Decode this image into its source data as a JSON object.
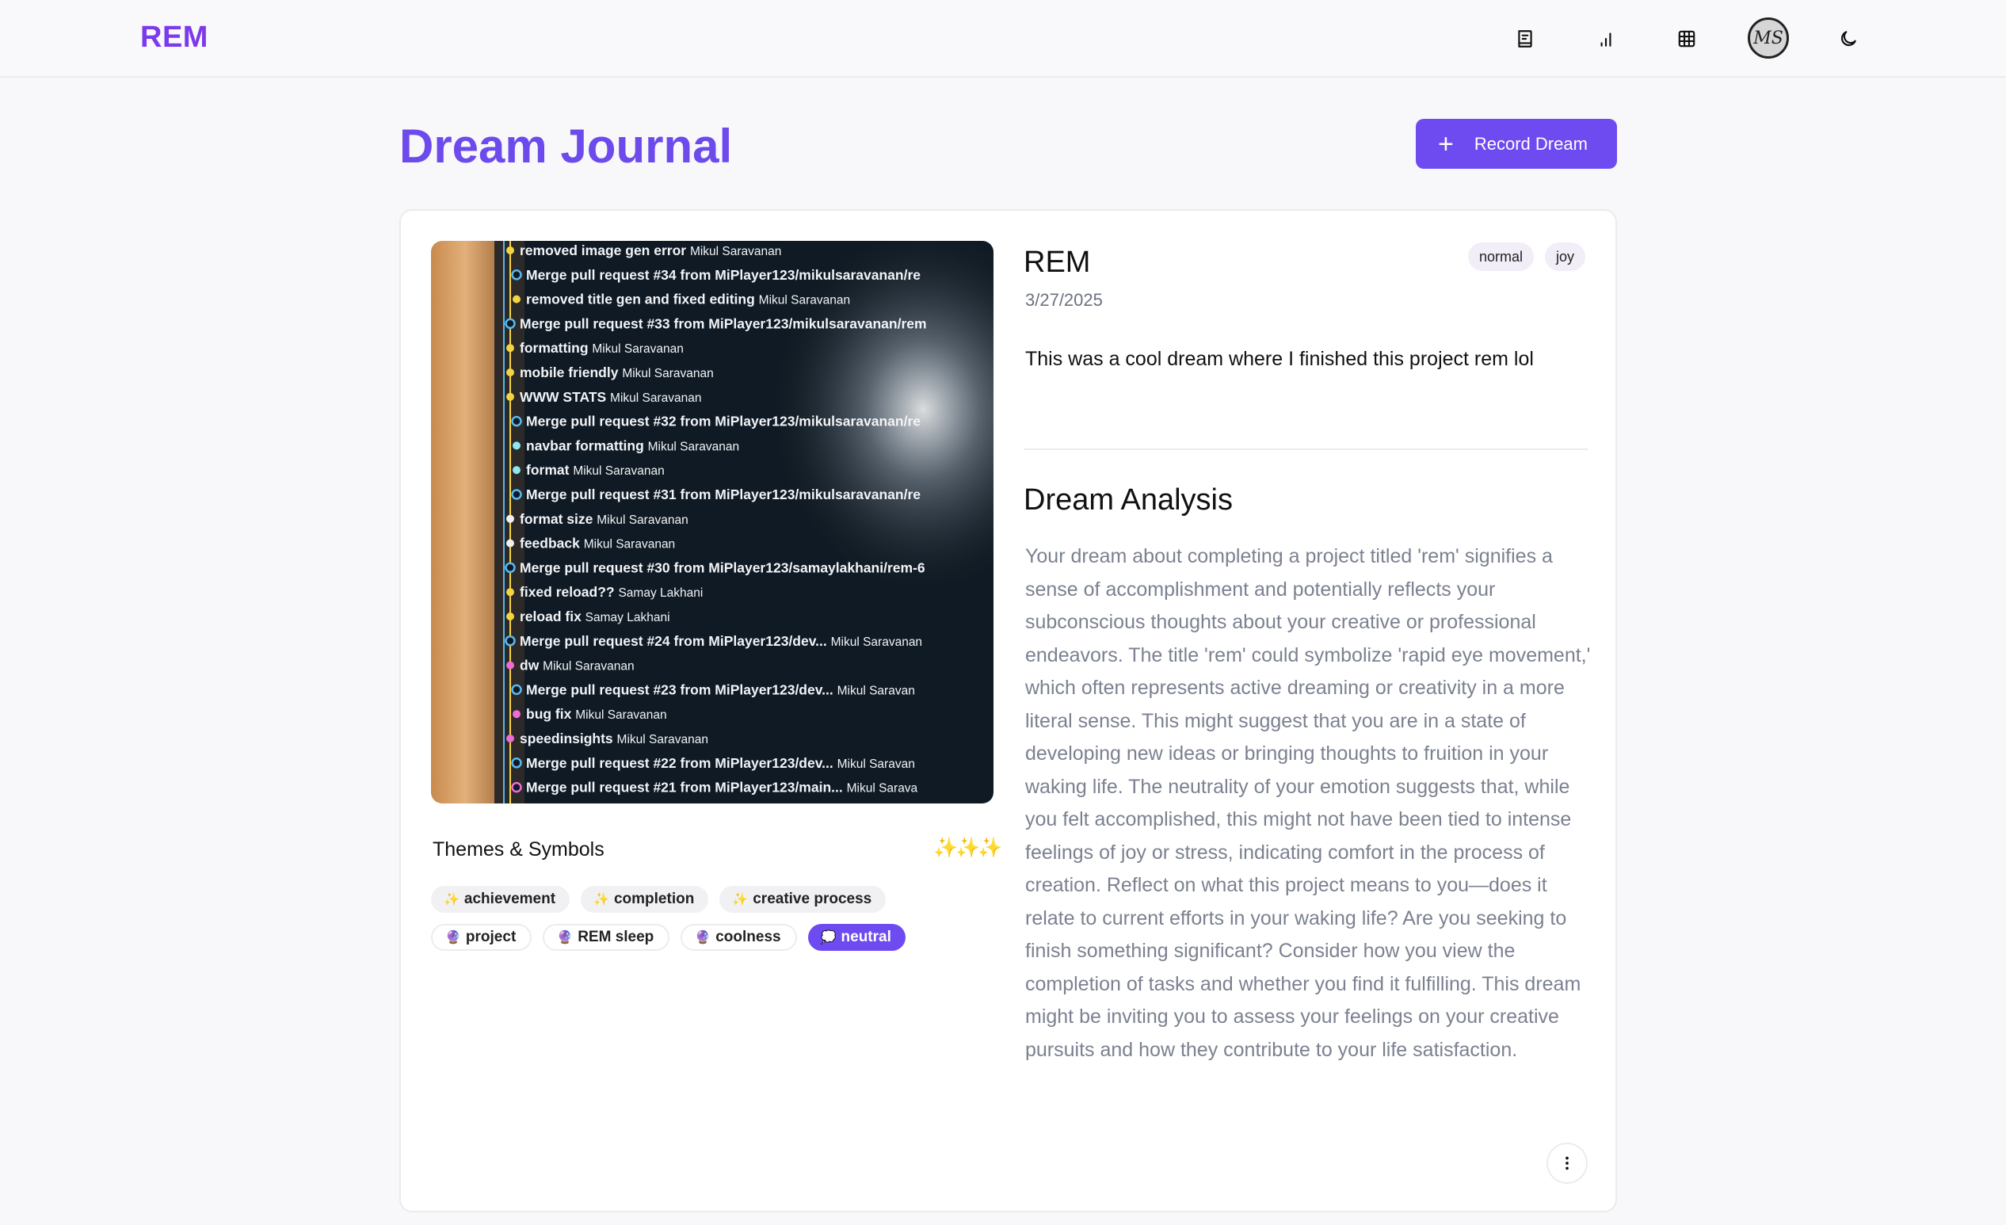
{
  "navbar": {
    "brand": "REM",
    "icons": [
      "journal-book-icon",
      "stats-chart-icon",
      "grid-table-icon",
      "avatar",
      "moon-icon"
    ],
    "avatar_initials": "MS"
  },
  "header": {
    "title": "Dream Journal",
    "record_button_label": "Record Dream"
  },
  "colors": {
    "accent": "#6e4bf0",
    "brand": "#7c3aed",
    "title": "#6d4aeb"
  },
  "dream": {
    "title": "REM",
    "date": "3/27/2025",
    "badges": [
      "normal",
      "joy"
    ],
    "text": "This was a cool dream where I finished this project rem lol",
    "analysis_title": "Dream Analysis",
    "analysis": "Your dream about completing a project titled 'rem' signifies a sense of accomplishment and potentially reflects your subconscious thoughts about your creative or professional endeavors. The title 'rem' could symbolize 'rapid eye movement,' which often represents active dreaming or creativity in a more literal sense. This might suggest that you are in a state of developing new ideas or bringing thoughts to fruition in your waking life. The neutrality of your emotion suggests that, while you felt accomplished, this might not have been tied to intense feelings of joy or stress, indicating comfort in the process of creation. Reflect on what this project means to you—does it relate to current efforts in your waking life? Are you seeking to finish something significant? Consider how you view the completion of tasks and whether you find it fulfilling. This dream might be inviting you to assess your feelings on your creative pursuits and how they contribute to your life satisfaction.",
    "themes_title": "Themes & Symbols",
    "themes": [
      "achievement",
      "completion",
      "creative process"
    ],
    "symbols": [
      "project",
      "REM sleep",
      "coolness"
    ],
    "emotion": "neutral"
  },
  "commits": [
    {
      "msg": "removed image gen error",
      "author": "Mikul Saravanan",
      "color": "#f5d442",
      "indent": 0,
      "node": "dot"
    },
    {
      "msg": "Merge pull request #34 from MiPlayer123/mikulsaravanan/re",
      "author": "",
      "color": "#5ab8f0",
      "indent": 1,
      "node": "ring"
    },
    {
      "msg": "removed title gen and fixed editing",
      "author": "Mikul Saravanan",
      "color": "#f5d442",
      "indent": 1,
      "node": "dot"
    },
    {
      "msg": "Merge pull request #33 from MiPlayer123/mikulsaravanan/rem",
      "author": "",
      "color": "#5ab8f0",
      "indent": 0,
      "node": "ring"
    },
    {
      "msg": "formatting",
      "author": "Mikul Saravanan",
      "color": "#f5d442",
      "indent": 0,
      "node": "dot"
    },
    {
      "msg": "mobile friendly",
      "author": "Mikul Saravanan",
      "color": "#f5d442",
      "indent": 0,
      "node": "dot"
    },
    {
      "msg": "WWW STATS",
      "author": "Mikul Saravanan",
      "color": "#f5d442",
      "indent": 0,
      "node": "dot"
    },
    {
      "msg": "Merge pull request #32 from MiPlayer123/mikulsaravanan/re",
      "author": "",
      "color": "#5ab8f0",
      "indent": 1,
      "node": "ring"
    },
    {
      "msg": "navbar formatting",
      "author": "Mikul Saravanan",
      "color": "#8ee6f0",
      "indent": 1,
      "node": "dot"
    },
    {
      "msg": "format",
      "author": "Mikul Saravanan",
      "color": "#8ee6f0",
      "indent": 1,
      "node": "dot"
    },
    {
      "msg": "Merge pull request #31 from MiPlayer123/mikulsaravanan/re",
      "author": "",
      "color": "#5ab8f0",
      "indent": 1,
      "node": "ring"
    },
    {
      "msg": "format size",
      "author": "Mikul Saravanan",
      "color": "#f0f0f0",
      "indent": 0,
      "node": "dot"
    },
    {
      "msg": "feedback",
      "author": "Mikul Saravanan",
      "color": "#f0f0f0",
      "indent": 0,
      "node": "dot"
    },
    {
      "msg": "Merge pull request #30 from MiPlayer123/samaylakhani/rem-6",
      "author": "",
      "color": "#5ab8f0",
      "indent": 0,
      "node": "ring"
    },
    {
      "msg": "fixed reload??",
      "author": "Samay Lakhani",
      "color": "#f5d442",
      "indent": 0,
      "node": "dot"
    },
    {
      "msg": "reload fix",
      "author": "Samay Lakhani",
      "color": "#f5d442",
      "indent": 0,
      "node": "dot"
    },
    {
      "msg": "Merge pull request #24 from MiPlayer123/dev...",
      "author": "Mikul Saravanan",
      "color": "#5ab8f0",
      "indent": 0,
      "node": "ring"
    },
    {
      "msg": "dw",
      "author": "Mikul Saravanan",
      "color": "#f06ad8",
      "indent": 0,
      "node": "dot"
    },
    {
      "msg": "Merge pull request #23 from MiPlayer123/dev...",
      "author": "Mikul Saravan",
      "color": "#5ab8f0",
      "indent": 1,
      "node": "ring"
    },
    {
      "msg": "bug fix",
      "author": "Mikul Saravanan",
      "color": "#f06ad8",
      "indent": 1,
      "node": "dot"
    },
    {
      "msg": "speedinsights",
      "author": "Mikul Saravanan",
      "color": "#f06ad8",
      "indent": 0,
      "node": "dot"
    },
    {
      "msg": "Merge pull request #22 from MiPlayer123/dev...",
      "author": "Mikul Saravan",
      "color": "#5ab8f0",
      "indent": 1,
      "node": "ring"
    },
    {
      "msg": "Merge pull request #21 from MiPlayer123/main...",
      "author": "Mikul Sarava",
      "color": "#f06ad8",
      "indent": 1,
      "node": "ring"
    }
  ]
}
